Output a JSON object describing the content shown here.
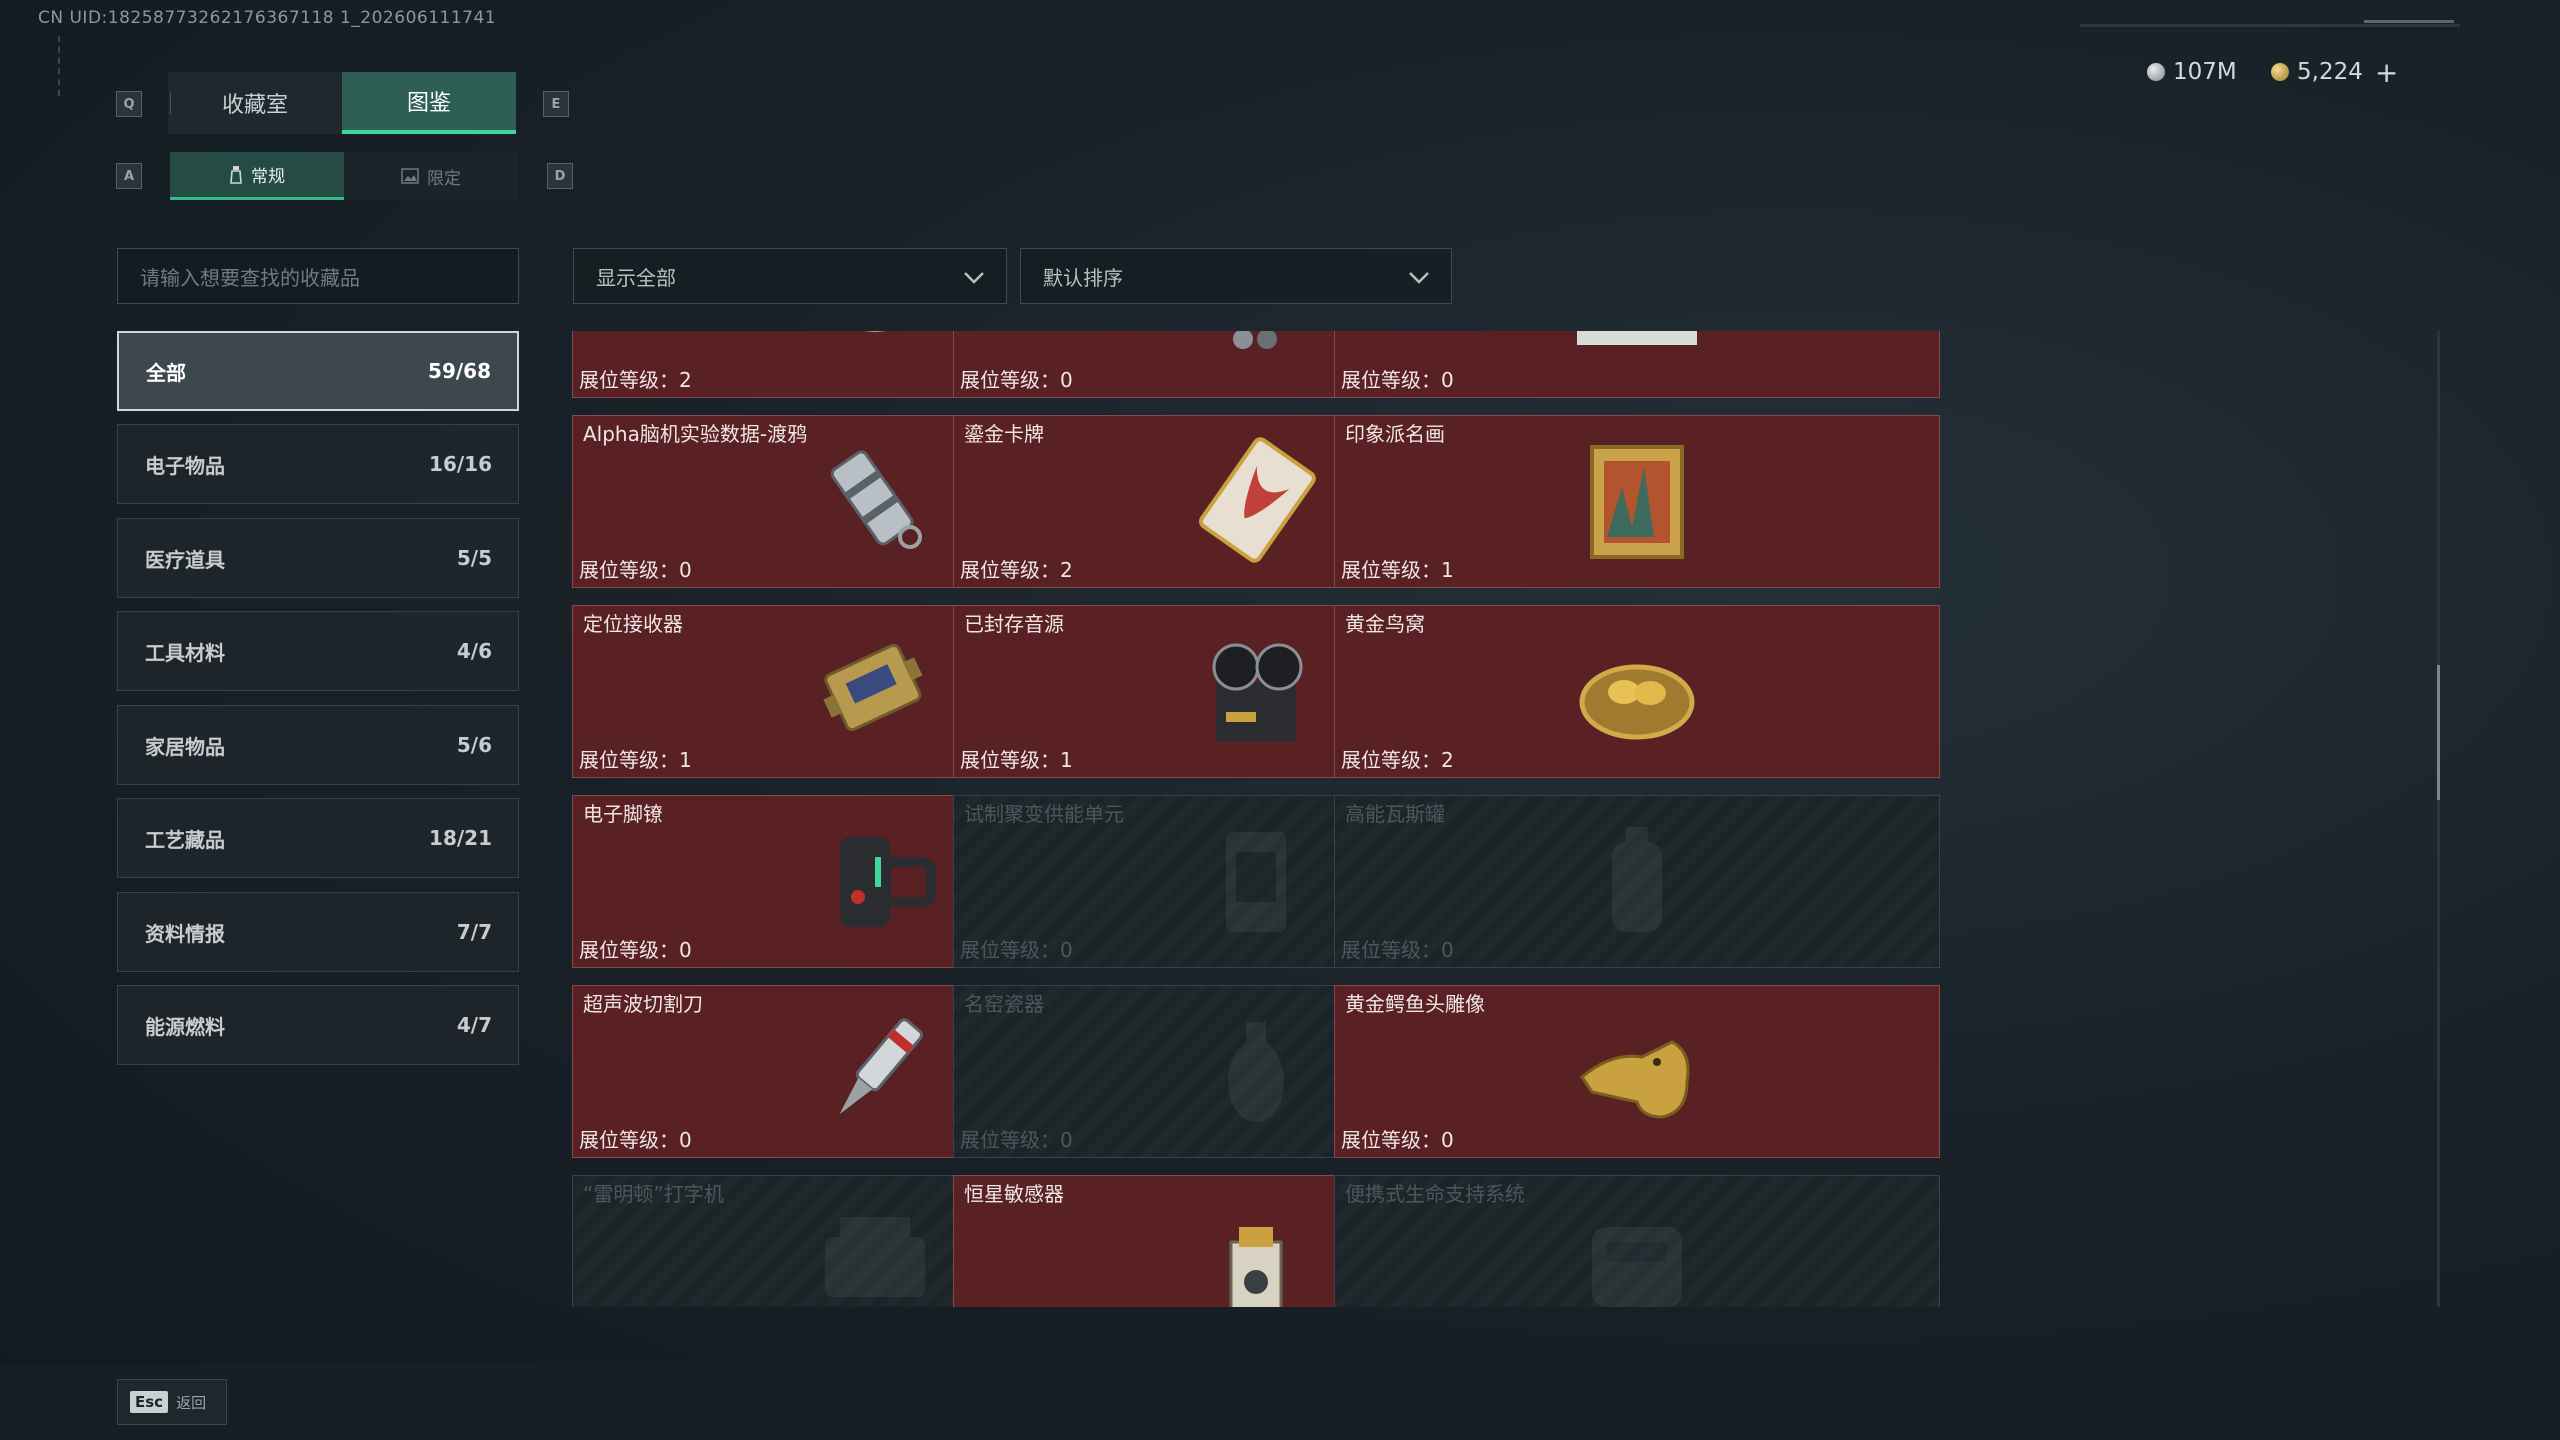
{
  "uid": "CN UID:18258773262176367118 1_202606111741",
  "hotkeys": {
    "prev_tab": "Q",
    "next_tab": "E",
    "prev_sub": "A",
    "next_sub": "D"
  },
  "tabs": [
    {
      "label": "收藏室"
    },
    {
      "label": "图鉴"
    }
  ],
  "subtabs": [
    {
      "label": "常规"
    },
    {
      "label": "限定"
    }
  ],
  "currency": {
    "silver": "107M",
    "gold": "5,224",
    "add": "+"
  },
  "search": {
    "placeholder": "请输入想要查找的收藏品"
  },
  "filters": {
    "show": "显示全部",
    "sort": "默认排序"
  },
  "categories": [
    {
      "name": "全部",
      "count": "59/68"
    },
    {
      "name": "电子物品",
      "count": "16/16"
    },
    {
      "name": "医疗道具",
      "count": "5/5"
    },
    {
      "name": "工具材料",
      "count": "4/6"
    },
    {
      "name": "家居物品",
      "count": "5/6"
    },
    {
      "name": "工艺藏品",
      "count": "18/21"
    },
    {
      "name": "资料情报",
      "count": "7/7"
    },
    {
      "name": "能源燃料",
      "count": "4/7"
    }
  ],
  "items": [
    {
      "name": "",
      "level": "展位等级：2",
      "icon": "caviar-tin-icon",
      "owned": true
    },
    {
      "name": "",
      "level": "展位等级：0",
      "icon": "device-icon",
      "owned": true
    },
    {
      "name": "",
      "level": "展位等级：0",
      "icon": "blueprint-map-icon",
      "owned": true
    },
    {
      "name": "Alpha脑机实验数据-渡鸦",
      "level": "展位等级：0",
      "icon": "data-canister-icon",
      "owned": true
    },
    {
      "name": "鎏金卡牌",
      "level": "展位等级：2",
      "icon": "gilded-card-icon",
      "owned": true
    },
    {
      "name": "印象派名画",
      "level": "展位等级：1",
      "icon": "framed-painting-icon",
      "owned": true
    },
    {
      "name": "定位接收器",
      "level": "展位等级：1",
      "icon": "receiver-icon",
      "owned": true
    },
    {
      "name": "已封存音源",
      "level": "展位等级：1",
      "icon": "reel-recorder-icon",
      "owned": true
    },
    {
      "name": "黄金鸟窝",
      "level": "展位等级：2",
      "icon": "golden-nest-icon",
      "owned": true
    },
    {
      "name": "电子脚镣",
      "level": "展位等级：0",
      "icon": "ankle-monitor-icon",
      "owned": true
    },
    {
      "name": "试制聚变供能单元",
      "level": "展位等级：0",
      "icon": "fusion-cell-icon",
      "owned": false
    },
    {
      "name": "高能瓦斯罐",
      "level": "展位等级：0",
      "icon": "gas-canister-icon",
      "owned": false
    },
    {
      "name": "超声波切割刀",
      "level": "展位等级：0",
      "icon": "ultrasonic-knife-icon",
      "owned": true
    },
    {
      "name": "名窑瓷器",
      "level": "展位等级：0",
      "icon": "porcelain-vase-icon",
      "owned": false
    },
    {
      "name": "黄金鳄鱼头雕像",
      "level": "展位等级：0",
      "icon": "gold-crocodile-icon",
      "owned": true
    },
    {
      "name": "“雷明顿”打字机",
      "level": "",
      "icon": "typewriter-icon",
      "owned": false
    },
    {
      "name": "恒星敏感器",
      "level": "",
      "icon": "star-sensor-icon",
      "owned": true
    },
    {
      "name": "便携式生命支持系统",
      "level": "",
      "icon": "life-support-icon",
      "owned": false
    }
  ],
  "footer": {
    "esc_key": "Esc",
    "back": "返回"
  },
  "colors": {
    "accent": "#3fd69b",
    "owned_card": "#5a2125",
    "locked_card": "#1c2428"
  }
}
